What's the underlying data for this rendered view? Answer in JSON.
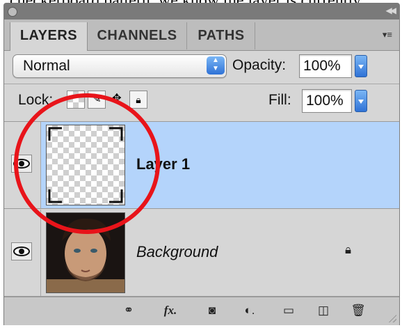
{
  "caption": {
    "text": "checkerboard pattern, we know the layer is currently"
  },
  "panel": {
    "tabs": [
      {
        "label": "LAYERS",
        "active": true
      },
      {
        "label": "CHANNELS",
        "active": false
      },
      {
        "label": "PATHS",
        "active": false
      }
    ],
    "blend_mode": {
      "value": "Normal"
    },
    "opacity": {
      "label": "Opacity:",
      "value": "100%"
    },
    "lock": {
      "label": "Lock:",
      "icons": [
        "lock-transparent-pixels-icon",
        "lock-image-pixels-icon",
        "lock-position-icon",
        "lock-all-icon"
      ]
    },
    "fill": {
      "label": "Fill:",
      "value": "100%"
    },
    "layers": [
      {
        "name": "Layer 1",
        "selected": true,
        "visible": true,
        "thumbnail": "transparent-checkerboard"
      },
      {
        "name": "Background",
        "selected": false,
        "visible": true,
        "locked": true,
        "thumbnail": "portrait-photo"
      }
    ],
    "bottom_icons": [
      "link-layers-icon",
      "fx-icon",
      "layer-mask-icon",
      "adjustment-layer-icon",
      "group-folder-icon",
      "new-layer-icon",
      "trash-icon"
    ]
  },
  "colors": {
    "selection": "#b4d4fb",
    "highlight_circle": "#e8141a",
    "panel_bg": "#d6d6d6",
    "accent_blue": "#2f72d6"
  }
}
